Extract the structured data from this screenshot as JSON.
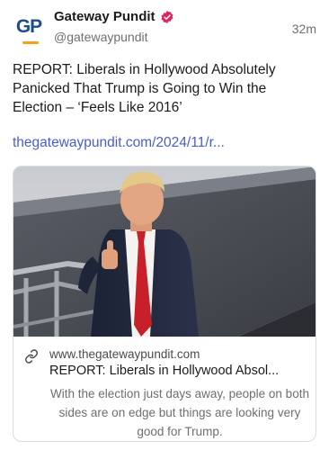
{
  "author": {
    "avatar_text": "GP",
    "display_name": "Gateway Pundit",
    "handle": "@gatewaypundit",
    "verified": true,
    "verified_color": "#e0245e"
  },
  "timestamp": "32m",
  "post": {
    "text": "REPORT: Liberals in Hollywood Absolutely Panicked That Trump is Going to Win the Election – ‘Feels Like 2016’",
    "link": "thegatewaypundit.com/2024/11/r..."
  },
  "card": {
    "domain": "www.thegatewaypundit.com",
    "title": "REPORT: Liberals in Hollywood Absol...",
    "description": "With the election just days away, people on both sides are on edge but things are looking very good for Trump."
  },
  "colors": {
    "link": "#4a5bd4",
    "text": "#1b1b1f",
    "muted": "#6e6e73",
    "avatar_blue": "#1d4e89",
    "avatar_orange": "#f2a21b"
  }
}
